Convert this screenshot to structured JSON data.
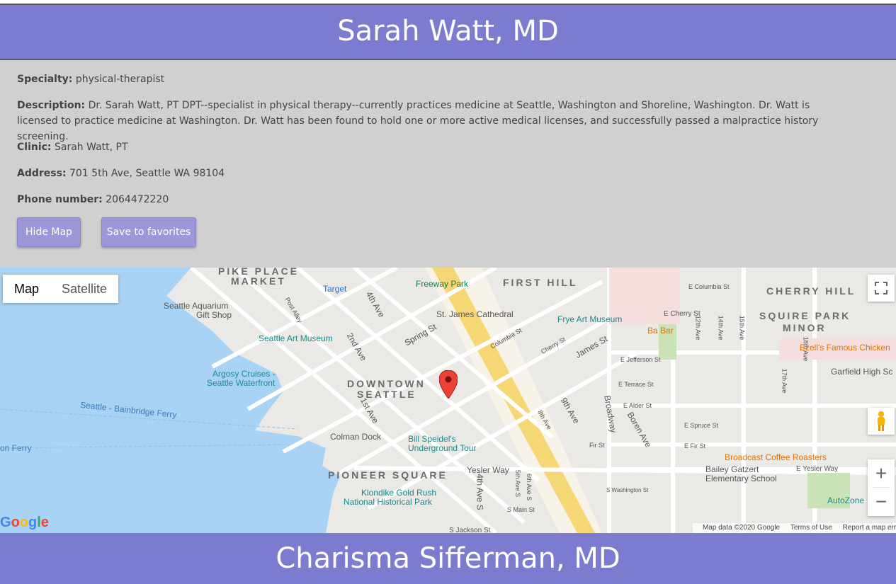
{
  "doctor": {
    "name": "Sarah Watt, MD",
    "specialty_label": "Specialty:",
    "specialty": "physical-therapist",
    "description_label": "Description:",
    "description": "Dr. Sarah Watt, PT DPT--specialist in physical therapy--currently practices medicine at Seattle, Washington and Shoreline, Washington. Dr. Watt is licensed to practice medicine at Washington. Dr. Watt has been found to hold one or more active medical licenses, and successfully passed a malpractice history screening.",
    "clinic_label": "Clinic:",
    "clinic": "Sarah Watt, PT",
    "address_label": "Address:",
    "address": "701 5th Ave, Seattle WA 98104",
    "phone_label": "Phone number:",
    "phone": "2064472220"
  },
  "buttons": {
    "hide_map": "Hide Map",
    "save_favorites": "Save to favorites"
  },
  "map": {
    "type_map": "Map",
    "type_satellite": "Satellite",
    "zoom_in": "+",
    "zoom_out": "−",
    "attribution": "Map data ©2020 Google",
    "terms": "Terms of Use",
    "report": "Report a map error",
    "logo": "Google",
    "area_labels": [
      "PIKE PLACE",
      "MARKET",
      "FIRST HILL",
      "CHERRY HILL",
      "SQUIRE PARK",
      "MINOR",
      "DOWNTOWN",
      "SEATTLE",
      "PIONEER SQUARE"
    ],
    "poi_labels": [
      "Target",
      "Freeway Park",
      "Seattle Aquarium",
      "Gift Shop",
      "Seattle Art Museum",
      "St. James Cathedral",
      "Frye Art Museum",
      "Ba Bar",
      "Ezell's Famous Chicken",
      "Garfield High Sc",
      "Argosy Cruises -",
      "Seattle Waterfront",
      "Colman Dock",
      "Bill Speidel's",
      "Underground Tour",
      "Broadcast Coffee Roasters",
      "Bailey Gatzert",
      "Elementary School",
      "Klondike Gold Rush",
      "National Historical Park",
      "AutoZone",
      "Seattle - Bainbridge Ferry",
      "on Ferry"
    ],
    "street_labels": [
      "2nd Ave",
      "4th Ave",
      "1st Ave",
      "Spring St",
      "James St",
      "Cherry St",
      "Columbia St",
      "9th Ave",
      "8th Ave",
      "Broadway",
      "Boren Ave",
      "Yesler Way",
      "E Yesler Way",
      "S Main St",
      "S Jackson St",
      "E Cherry St",
      "E Columbia St",
      "E Jefferson St",
      "E Terrace St",
      "E Alder St",
      "E Spruce St",
      "E Fir St",
      "12th Ave",
      "14th Ave",
      "15th Ave",
      "17th Ave",
      "18th Ave",
      "5th Ave S",
      "4th Ave S",
      "6th Ave S",
      "Post Alley",
      "S Washington St",
      "Fir St"
    ]
  },
  "next_doctor": {
    "name": "Charisma Sifferman, MD"
  },
  "colors": {
    "header": "#7b7bcf",
    "button": "#9b97d8",
    "panel": "#d0d0d0",
    "water": "#a9d3f5",
    "pin": "#ea4335"
  }
}
